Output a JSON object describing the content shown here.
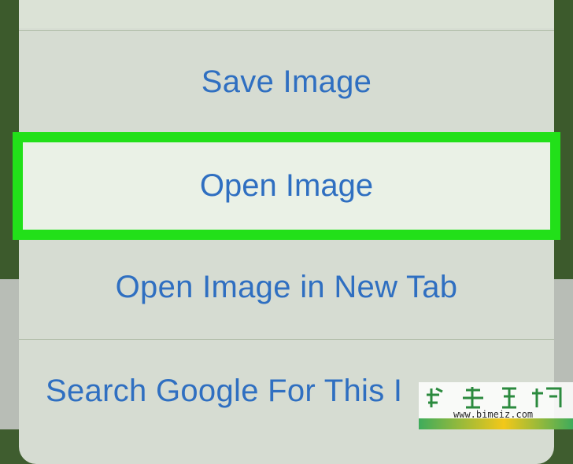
{
  "menu": {
    "items": [
      {
        "label": "Save Image"
      },
      {
        "label": "Open Image"
      },
      {
        "label": "Open Image in New Tab"
      },
      {
        "label": "Search Google For This I"
      }
    ]
  },
  "highlight_color": "#22e019",
  "link_color": "#2f6fc1",
  "watermark": {
    "url": "www.bimeiz.com",
    "logo_text": "生活百科"
  }
}
